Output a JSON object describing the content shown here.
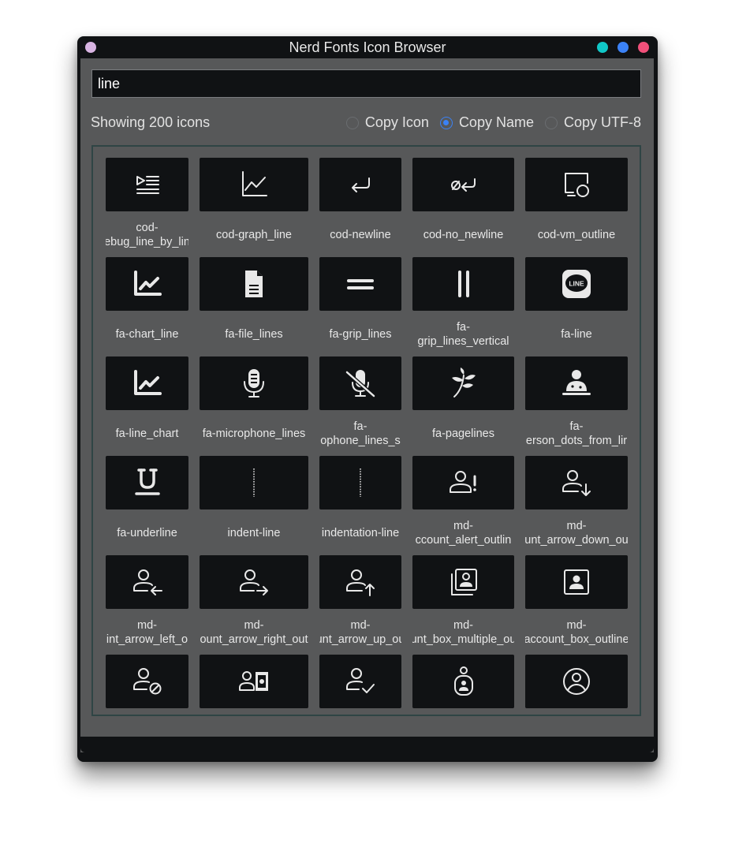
{
  "window": {
    "title": "Nerd Fonts Icon Browser",
    "accent_left": "#d8b4e2",
    "traffic_lights": [
      "#10c7c7",
      "#3b82f6",
      "#f0507a"
    ]
  },
  "search": {
    "value": "line"
  },
  "status": {
    "text": "Showing 200 icons"
  },
  "copy_modes": [
    {
      "label": "Copy Icon",
      "selected": false
    },
    {
      "label": "Copy Name",
      "selected": true
    },
    {
      "label": "Copy UTF-8",
      "selected": false
    }
  ],
  "icons": [
    {
      "lines": [
        "cod-",
        "ebug_line_by_lin"
      ],
      "icon": "debug-line-by-line-icon"
    },
    {
      "lines": [
        "cod-graph_line"
      ],
      "icon": "graph-line-icon"
    },
    {
      "lines": [
        "cod-newline"
      ],
      "icon": "newline-icon"
    },
    {
      "lines": [
        "cod-no_newline"
      ],
      "icon": "no-newline-icon"
    },
    {
      "lines": [
        "cod-vm_outline"
      ],
      "icon": "vm-outline-icon"
    },
    {
      "lines": [
        "fa-chart_line"
      ],
      "icon": "chart-line-icon"
    },
    {
      "lines": [
        "fa-file_lines"
      ],
      "icon": "file-lines-icon"
    },
    {
      "lines": [
        "fa-grip_lines"
      ],
      "icon": "grip-lines-icon"
    },
    {
      "lines": [
        "fa-",
        "grip_lines_vertical"
      ],
      "icon": "grip-lines-vertical-icon"
    },
    {
      "lines": [
        "fa-line"
      ],
      "icon": "line-app-icon"
    },
    {
      "lines": [
        "fa-line_chart"
      ],
      "icon": "line-chart-icon"
    },
    {
      "lines": [
        "fa-microphone_lines"
      ],
      "icon": "microphone-lines-icon"
    },
    {
      "lines": [
        "fa-",
        "ophone_lines_s"
      ],
      "icon": "microphone-lines-slash-icon"
    },
    {
      "lines": [
        "fa-pagelines"
      ],
      "icon": "pagelines-icon"
    },
    {
      "lines": [
        "fa-",
        "erson_dots_from_lir"
      ],
      "icon": "person-dots-from-line-icon"
    },
    {
      "lines": [
        "fa-underline"
      ],
      "icon": "underline-icon"
    },
    {
      "lines": [
        "indent-line"
      ],
      "icon": "indent-line-icon"
    },
    {
      "lines": [
        "indentation-line"
      ],
      "icon": "indentation-line-icon"
    },
    {
      "lines": [
        "md-",
        "ccount_alert_outlin"
      ],
      "icon": "account-alert-outline-icon"
    },
    {
      "lines": [
        "md-",
        "unt_arrow_down_ou"
      ],
      "icon": "account-arrow-down-outline-icon"
    },
    {
      "lines": [
        "md-",
        "int_arrow_left_o"
      ],
      "icon": "account-arrow-left-outline-icon"
    },
    {
      "lines": [
        "md-",
        "ount_arrow_right_out"
      ],
      "icon": "account-arrow-right-outline-icon"
    },
    {
      "lines": [
        "md-",
        "unt_arrow_up_ou"
      ],
      "icon": "account-arrow-up-outline-icon"
    },
    {
      "lines": [
        "md-",
        "unt_box_multiple_ou"
      ],
      "icon": "account-box-multiple-outline-icon"
    },
    {
      "lines": [
        "md-",
        "account_box_outline"
      ],
      "icon": "account-box-outline-icon"
    },
    {
      "lines": [],
      "icon": "account-cancel-outline-icon"
    },
    {
      "lines": [],
      "icon": "account-cash-outline-icon"
    },
    {
      "lines": [],
      "icon": "account-check-outline-icon"
    },
    {
      "lines": [],
      "icon": "account-child-outline-icon"
    },
    {
      "lines": [],
      "icon": "account-circle-outline-icon"
    }
  ]
}
